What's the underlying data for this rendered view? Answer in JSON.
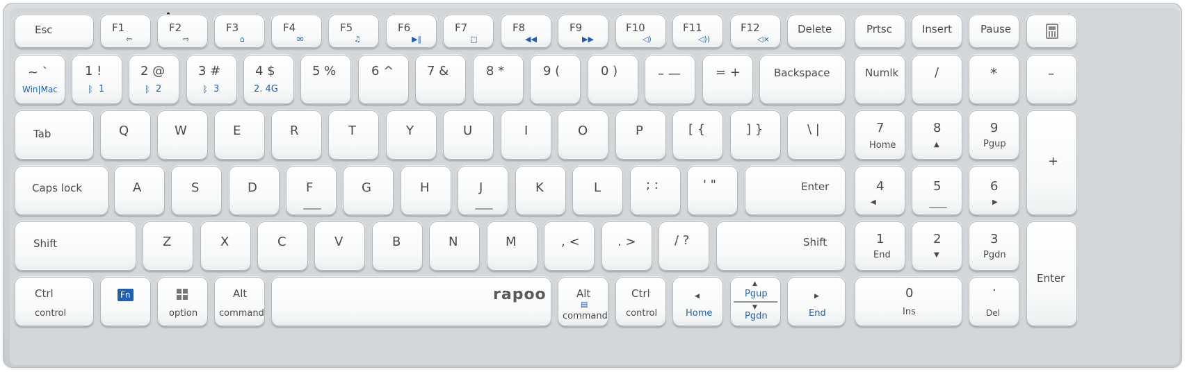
{
  "keyboard": {
    "brand": "rapoo",
    "esc": "Esc",
    "f1": "F1",
    "f2": "F2",
    "f3": "F3",
    "f4": "F4",
    "f5": "F5",
    "f6": "F6",
    "f7": "F7",
    "f8": "F8",
    "f9": "F9",
    "f10": "F10",
    "f11": "F11",
    "f12": "F12",
    "delete": "Delete",
    "prtsc": "Prtsc",
    "insert": "Insert",
    "pause": "Pause",
    "tilde_top": "~ `",
    "tilde_bottom": "Win|Mac",
    "k1_top": "1  !",
    "k1_bottom": "1",
    "k2_top": "2 @",
    "k2_bottom": "2",
    "k3_top": "3  #",
    "k3_bottom": "3",
    "k4_top": "4  $",
    "k4_bottom": "2. 4G",
    "k5": "5 %",
    "k6": "6 ^",
    "k7": "7 &",
    "k8": "8 *",
    "k9": "9  (",
    "k0": "0  )",
    "minus": "– —",
    "equals": "= +",
    "backspace": "Backspace",
    "numlk": "Numlk",
    "np_slash": "/",
    "np_star": "*",
    "np_minus": "–",
    "tab": "Tab",
    "q": "Q",
    "w": "W",
    "e": "E",
    "r": "R",
    "t": "T",
    "y": "Y",
    "u": "U",
    "i": "I",
    "o": "O",
    "p": "P",
    "lbracket": "[ {",
    "rbracket": "] }",
    "backslash": "\\  |",
    "np7": "7",
    "np7_sub": "Home",
    "np8": "8",
    "np8_sub": "▲",
    "np9": "9",
    "np9_sub": "Pgup",
    "np_plus": "+",
    "capslock": "Caps lock",
    "a": "A",
    "s": "S",
    "d": "D",
    "f": "F",
    "g": "G",
    "h": "H",
    "j": "J",
    "k": "K",
    "l": "L",
    "semicolon": "; :",
    "quote": "' \"",
    "enter": "Enter",
    "np4": "4",
    "np4_sub": "◀",
    "np5": "5",
    "np6": "6",
    "np6_sub": "▶",
    "lshift": "Shift",
    "z": "Z",
    "x": "X",
    "c": "C",
    "v": "V",
    "b": "B",
    "n": "N",
    "m": "M",
    "comma": ", <",
    "period": ". >",
    "slash": "/ ?",
    "rshift": "Shift",
    "np1": "1",
    "np1_sub": "End",
    "np2": "2",
    "np2_sub": "▼",
    "np3": "3",
    "np3_sub": "Pgdn",
    "np_enter": "Enter",
    "ctrl_top": "Ctrl",
    "ctrl_bottom": "control",
    "fn": "Fn",
    "win_bottom": "option",
    "alt_top": "Alt",
    "alt_bottom": "command",
    "ralt_top": "Alt",
    "ralt_bottom": "command",
    "rctrl_top": "Ctrl",
    "rctrl_bottom": "control",
    "home": "Home",
    "pgup": "Pgup",
    "pgdn": "Pgdn",
    "end": "End",
    "np0": "0",
    "np0_sub": "Ins",
    "npdot": "·",
    "npdot_sub": "Del"
  }
}
